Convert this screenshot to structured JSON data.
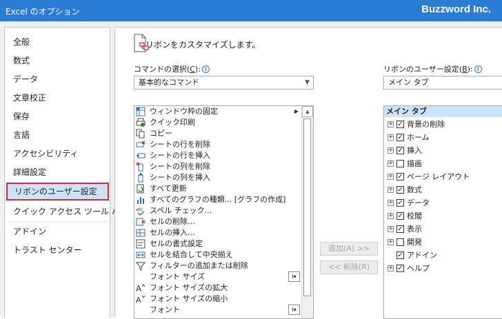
{
  "window": {
    "title": "Excel のオプション",
    "brand": "Buzzword Inc."
  },
  "sidebar": {
    "items": [
      {
        "label": "全般"
      },
      {
        "label": "数式"
      },
      {
        "label": "データ"
      },
      {
        "label": "文章校正"
      },
      {
        "label": "保存"
      },
      {
        "label": "言語"
      },
      {
        "label": "アクセシビリティ"
      },
      {
        "label": "詳細設定"
      },
      {
        "label": "リボンのユーザー設定",
        "selected": true
      },
      {
        "label": "クイック アクセス ツール バー"
      },
      {
        "label": "アドイン"
      },
      {
        "label": "トラスト センター"
      }
    ]
  },
  "main": {
    "heading": "リボンをカスタマイズします。",
    "commands": {
      "label": "コマンドの選択(",
      "label_key": "C",
      "label_end": "):",
      "selected": "基本的なコマンド",
      "items": [
        {
          "text": "ウィンドウ枠の固定",
          "icon": "freeze-panes-icon",
          "suffix": "▶"
        },
        {
          "text": "クイック印刷",
          "icon": "quick-print-icon"
        },
        {
          "text": "コピー",
          "icon": "copy-icon"
        },
        {
          "text": "シートの行を削除",
          "icon": "delete-row-icon"
        },
        {
          "text": "シートの行を挿入",
          "icon": "insert-row-icon"
        },
        {
          "text": "シートの列を削除",
          "icon": "delete-column-icon"
        },
        {
          "text": "シートの列を挿入",
          "icon": "insert-column-icon"
        },
        {
          "text": "すべて更新",
          "icon": "refresh-all-icon"
        },
        {
          "text": "すべてのグラフの種類... [グラフの作成]",
          "icon": "chart-types-icon"
        },
        {
          "text": "スペル チェック...",
          "icon": "spelling-icon"
        },
        {
          "text": "セルの削除...",
          "icon": "delete-cells-icon"
        },
        {
          "text": "セルの挿入...",
          "icon": "insert-cells-icon"
        },
        {
          "text": "セルの書式設定",
          "icon": "format-cells-icon"
        },
        {
          "text": "セルを結合して中央揃え",
          "icon": "merge-center-icon"
        },
        {
          "text": "フィルターの追加または削除",
          "icon": "filter-icon"
        },
        {
          "text": "フォント サイズ",
          "icon": "",
          "box": true
        },
        {
          "text": "フォント サイズの拡大",
          "icon": "font-grow-icon"
        },
        {
          "text": "フォント サイズの縮小",
          "icon": "font-shrink-icon"
        },
        {
          "text": "フォント",
          "icon": "",
          "box": true
        }
      ]
    },
    "buttons": {
      "add": "追加(A) >>",
      "remove": "<< 削除(R)"
    },
    "ribbon": {
      "label": "リボンのユーザー設定(",
      "label_key": "B",
      "label_end": "):",
      "selected": "メイン タブ",
      "header": "メイン タブ",
      "tabs": [
        {
          "label": "背景の削除",
          "checked": true,
          "expand": true
        },
        {
          "label": "ホーム",
          "checked": true,
          "expand": true
        },
        {
          "label": "挿入",
          "checked": true,
          "expand": true
        },
        {
          "label": "描画",
          "checked": false,
          "expand": true
        },
        {
          "label": "ページ レイアウト",
          "checked": true,
          "expand": true
        },
        {
          "label": "数式",
          "checked": true,
          "expand": true
        },
        {
          "label": "データ",
          "checked": true,
          "expand": true
        },
        {
          "label": "校閲",
          "checked": true,
          "expand": true
        },
        {
          "label": "表示",
          "checked": true,
          "expand": true
        },
        {
          "label": "開発",
          "checked": false,
          "expand": true
        },
        {
          "label": "アドイン",
          "checked": true,
          "expand": false
        },
        {
          "label": "ヘルプ",
          "checked": true,
          "expand": true
        }
      ]
    }
  },
  "colors": {
    "titlebar": "#2b7cd3",
    "selection": "#cde3f7",
    "highlight_border": "#d9262f"
  }
}
